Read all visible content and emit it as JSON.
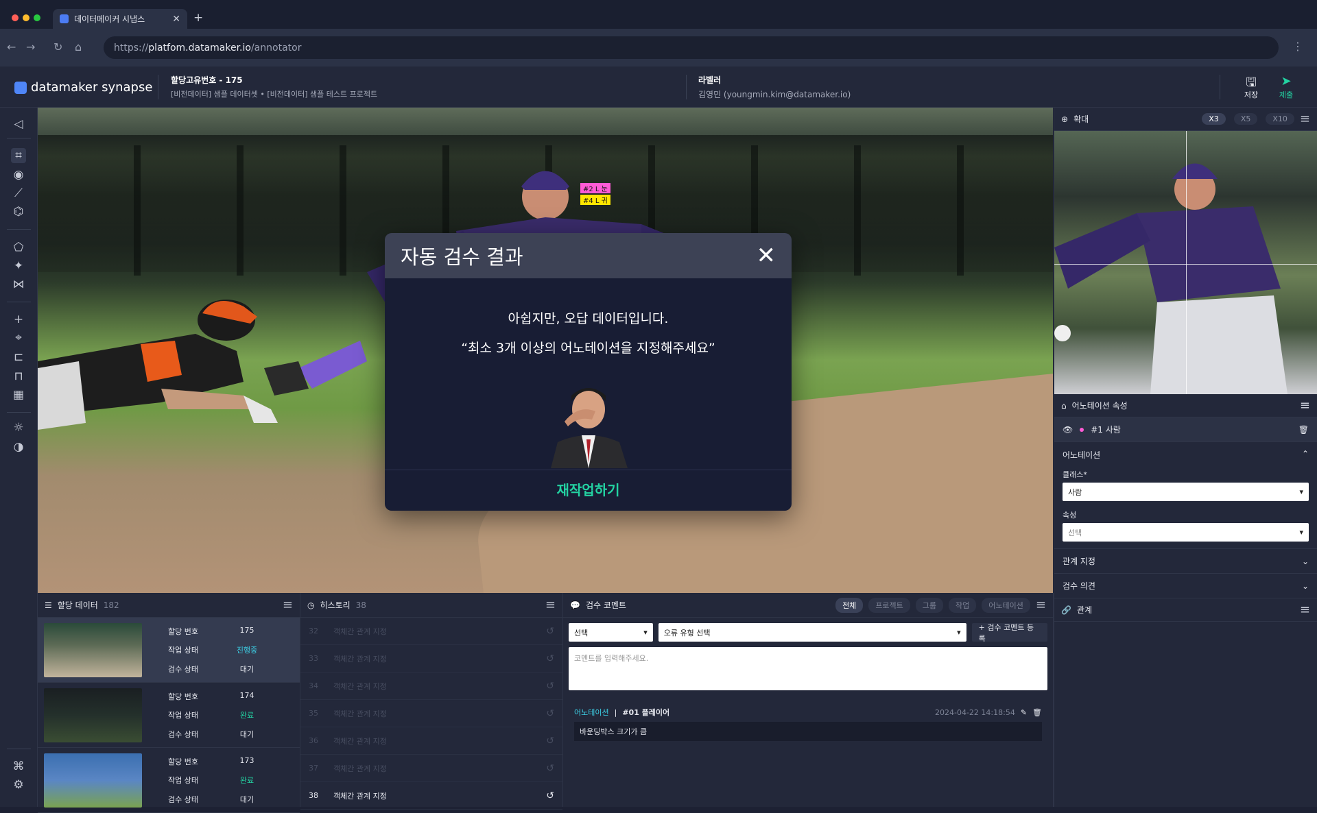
{
  "browser": {
    "tab_title": "데이터메이커 시냅스",
    "new_tab": "+",
    "close_tab": "✕",
    "url_prefix": "https://",
    "url_host": "platfom.datamaker.io",
    "url_path": "/annotator"
  },
  "header": {
    "logo": "datamaker synapse",
    "assignment_title": "할당고유번호 - 175",
    "assignment_sub": "[비전데이터] 샘플 데이터셋 • [비전데이터] 샘플 테스트 프로젝트",
    "labeler_title": "라벨러",
    "labeler_user": "김영민 (youngmin.kim@datamaker.io)",
    "save_label": "저장",
    "submit_label": "제출"
  },
  "annotations_overlay": [
    "#2 L 눈",
    "#4 L 귀"
  ],
  "modal": {
    "title": "자동 검수 결과",
    "line1": "아쉽지만, 오답 데이터입니다.",
    "line2": "“최소 3개 이상의 어노테이션을 지정해주세요”",
    "action": "재작업하기"
  },
  "right_panel": {
    "zoom_title": "확대",
    "zoom_options": [
      "X3",
      "X5",
      "X10"
    ],
    "zoom_selected": "X3",
    "attr_title": "어노테이션 속성",
    "selected_item": "#1 사람",
    "annotation_section": "어노테이션",
    "class_label": "클래스*",
    "class_value": "사람",
    "attr_label": "속성",
    "attr_placeholder": "선택",
    "relation_assign": "관계 지정",
    "review_opinion": "검수 의견",
    "relation_title": "관계"
  },
  "assigned_panel": {
    "title": "할당 데이터",
    "count": "182",
    "field_labels": [
      "할당 번호",
      "작업 상태",
      "검수 상태"
    ],
    "rows": [
      {
        "id": "175",
        "work": "진행중",
        "review": "대기"
      },
      {
        "id": "174",
        "work": "완료",
        "review": "대기"
      },
      {
        "id": "173",
        "work": "완료",
        "review": "대기"
      }
    ]
  },
  "history_panel": {
    "title": "히스토리",
    "count": "38",
    "rows": [
      {
        "n": "32",
        "text": "객체간 관계 지정"
      },
      {
        "n": "33",
        "text": "객체간 관계 지정"
      },
      {
        "n": "34",
        "text": "객체간 관계 지정"
      },
      {
        "n": "35",
        "text": "객체간 관계 지정"
      },
      {
        "n": "36",
        "text": "객체간 관계 지정"
      },
      {
        "n": "37",
        "text": "객체간 관계 지정"
      },
      {
        "n": "38",
        "text": "객체간 관계 지정"
      }
    ]
  },
  "comment_panel": {
    "title": "검수 코멘트",
    "tabs": [
      "전체",
      "프로젝트",
      "그룹",
      "작업",
      "어노테이션"
    ],
    "select1": "선택",
    "select2": "오류 유형 선택",
    "register_btn": "+ 검수 코멘트 등록",
    "textarea_placeholder": "코멘트를 입력해주세요.",
    "comment_type": "어노테이션",
    "comment_sep": "|",
    "comment_target": "#01 플레이어",
    "comment_time": "2024-04-22 14:18:54",
    "comment_body": "바운딩박스 크기가 큼"
  }
}
